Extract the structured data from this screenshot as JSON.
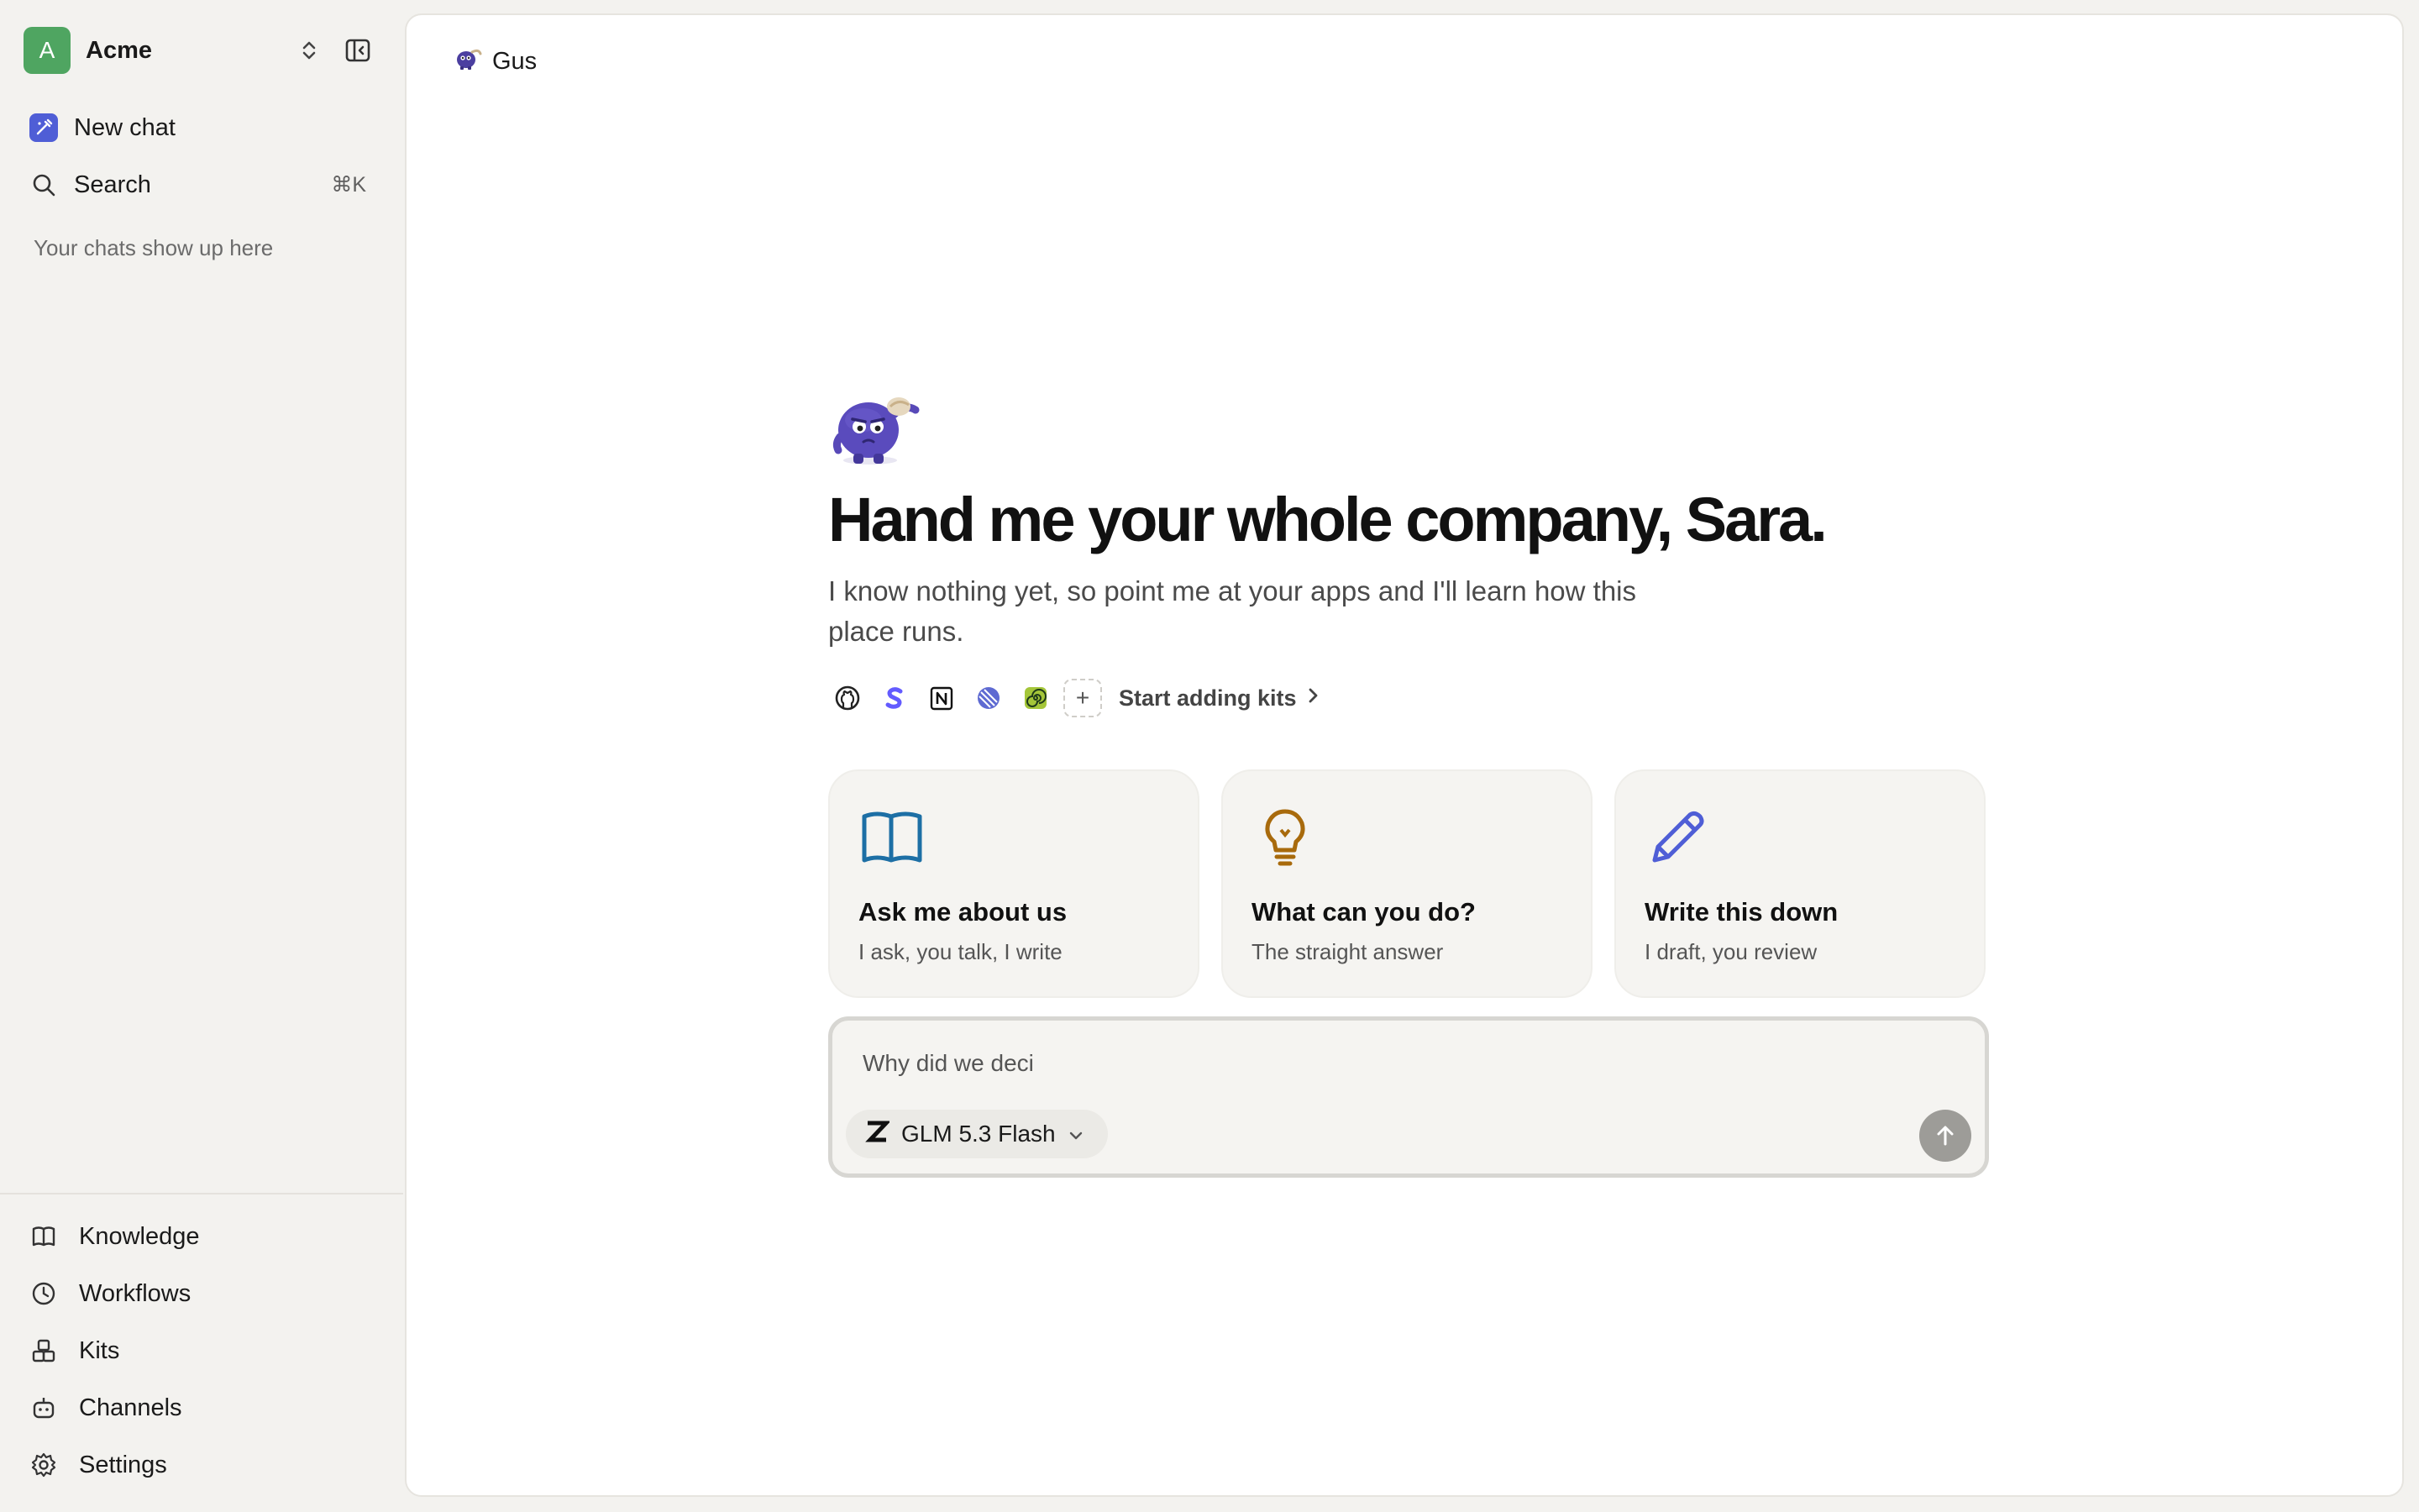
{
  "workspace": {
    "avatar_letter": "A",
    "name": "Acme"
  },
  "nav": {
    "new_chat": "New chat",
    "search": "Search",
    "search_shortcut": "⌘K",
    "empty_hint": "Your chats show up here"
  },
  "bottom_nav": [
    {
      "label": "Knowledge",
      "icon": "book-icon"
    },
    {
      "label": "Workflows",
      "icon": "clock-icon"
    },
    {
      "label": "Kits",
      "icon": "kits-icon"
    },
    {
      "label": "Channels",
      "icon": "bot-icon"
    },
    {
      "label": "Settings",
      "icon": "gear-icon"
    }
  ],
  "tab": {
    "label": "Gus"
  },
  "hero": {
    "headline": "Hand me your whole company, Sara.",
    "subline": "I know nothing yet, so point me at your apps and I'll learn how this place runs."
  },
  "kits": {
    "icons": [
      "github-icon",
      "stripe-icon",
      "notion-icon",
      "linear-icon",
      "spiral-icon"
    ],
    "add": "+",
    "link_label": "Start adding kits"
  },
  "cards": [
    {
      "title": "Ask me about us",
      "subtitle": "I ask, you talk, I write",
      "icon": "open-book-icon",
      "color": "#1d6fa5"
    },
    {
      "title": "What can you do?",
      "subtitle": "The straight answer",
      "icon": "lightbulb-icon",
      "color": "#a86a0c"
    },
    {
      "title": "Write this down",
      "subtitle": "I draft, you review",
      "icon": "pencil-icon",
      "color": "#4f5ed6"
    }
  ],
  "composer": {
    "value": "Why did we deci",
    "model": "GLM 5.3 Flash"
  },
  "colors": {
    "accent": "#4f5ed6",
    "workspace_avatar": "#4fa561",
    "sidebar_bg": "#f3f2ef",
    "send_button": "#9d9c98"
  }
}
